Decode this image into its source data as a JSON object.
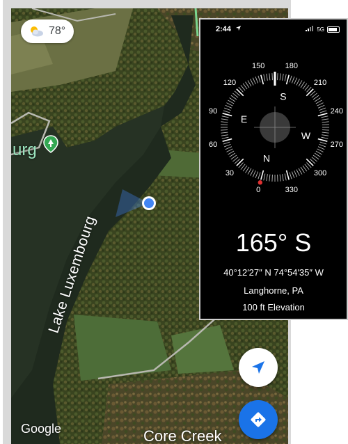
{
  "map": {
    "weather": {
      "icon": "partly-cloudy-icon",
      "temperature": "78°"
    },
    "place_label": "urg",
    "lake_label": "Lake Luxembourg",
    "bottom_label": "Core Creek",
    "attribution": "Google",
    "buttons": {
      "locate_icon": "navigation-arrow-icon",
      "directions_icon": "directions-icon"
    },
    "colors": {
      "accent_blue": "#1a73e8",
      "location_dot": "#4285f4",
      "place_green": "#34a853"
    }
  },
  "compass": {
    "status": {
      "time": "2:44",
      "network": "5G"
    },
    "degree_labels": [
      "0",
      "30",
      "60",
      "90",
      "120",
      "150",
      "180",
      "210",
      "240",
      "270",
      "300",
      "330"
    ],
    "cardinals": {
      "north": "N",
      "east": "E",
      "south": "S",
      "west": "W"
    },
    "heading_value": 165,
    "heading": "165° S",
    "coordinates": "40°12′27″ N  74°54′35″ W",
    "city": "Langhorne, PA",
    "elevation": "100 ft Elevation",
    "colors": {
      "north_marker": "#e03131"
    }
  }
}
